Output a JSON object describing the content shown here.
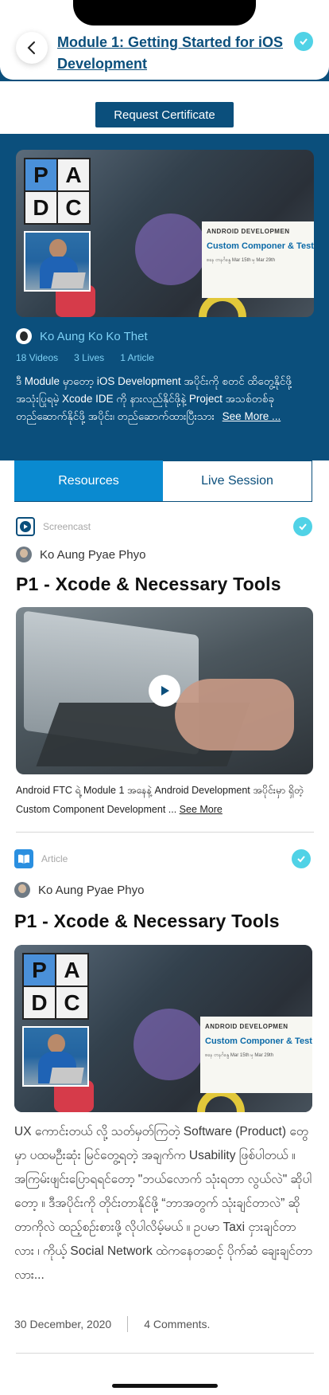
{
  "header": {
    "title": "Module 1: Getting Started for iOS Development",
    "back_icon": "chevron-left-icon",
    "completed_icon": "check-circle-icon",
    "accent_color": "#0b4f7c"
  },
  "certificate": {
    "button_label": "Request Certificate"
  },
  "hero": {
    "image_logo_letters": [
      "P",
      "A",
      "D",
      "C"
    ],
    "image_banner": {
      "heading": "ANDROID DEVELOPMEN",
      "title": "Custom Componer & Test Automatio",
      "subtitle": "စနေ တနင်္ဂနွေ Mar 15th မှ Mar 29th"
    },
    "author": "Ko Aung Ko Ko Thet",
    "stats": {
      "videos": "18 Videos",
      "lives": "3 Lives",
      "articles": "1 Article"
    },
    "description": "ဒီ Module မှာတော့ iOS Development အပိုင်းကို စတင် ထိတွေ့နိုင်ဖို့ အသုံးပြုရမဲ့ Xcode IDE ကို နားလည်နိုင်ဖို့နဲ့ Project အသစ်တစ်ခု တည်ဆောက်နိုင်ဖို့ အပိုင်း၊ တည်ဆောက်ထားပြီးသား",
    "see_more": "See More ..."
  },
  "tabs": [
    {
      "label": "Resources",
      "active": true
    },
    {
      "label": "Live Session",
      "active": false
    }
  ],
  "resources": [
    {
      "type_label": "Screencast",
      "type_icon": "play-square-icon",
      "author": "Ko Aung Pyae Phyo",
      "title": "P1 - Xcode & Necessary Tools",
      "description": "Android FTC ရဲ့ Module 1 အနေနဲ့ Android Development အပိုင်းမှာ ရှိတဲ့ Custom Component Development ...",
      "see_more": "See More",
      "completed": true
    },
    {
      "type_label": "Article",
      "type_icon": "book-icon",
      "author": "Ko Aung Pyae Phyo",
      "title": "P1 - Xcode & Necessary Tools",
      "body": "UX ကောင်းတယ် လို့ သတ်မှတ်ကြတဲ့ Software (Product) တွေမှာ ပထမဦးဆုံး မြင်တွေ့ရတဲ့ အချက်က Usability ဖြစ်ပါတယ် ။ အကြမ်းဖျင်းပြောရရင်တော့ \"ဘယ်လောက် သုံးရတာ လွယ်လဲ\" ဆိုပါတော့ ။ ဒီအပိုင်းကို တိုင်းတာနိုင်ဖို့ “ဘာအတွက် သုံးချင်တာလဲ” ဆိုတာကိုလဲ ထည့်စဉ်းစားဖို့ လိုပါလိမ့်မယ် ။ ဥပမာ Taxi ငှားချင်တာလား ၊ ကိုယ့် Social Network ထဲကနေတဆင့် ပိုက်ဆံ ချေးချင်တာလား...",
      "date": "30 December, 2020",
      "comments": "4 Comments.",
      "completed": true
    }
  ]
}
